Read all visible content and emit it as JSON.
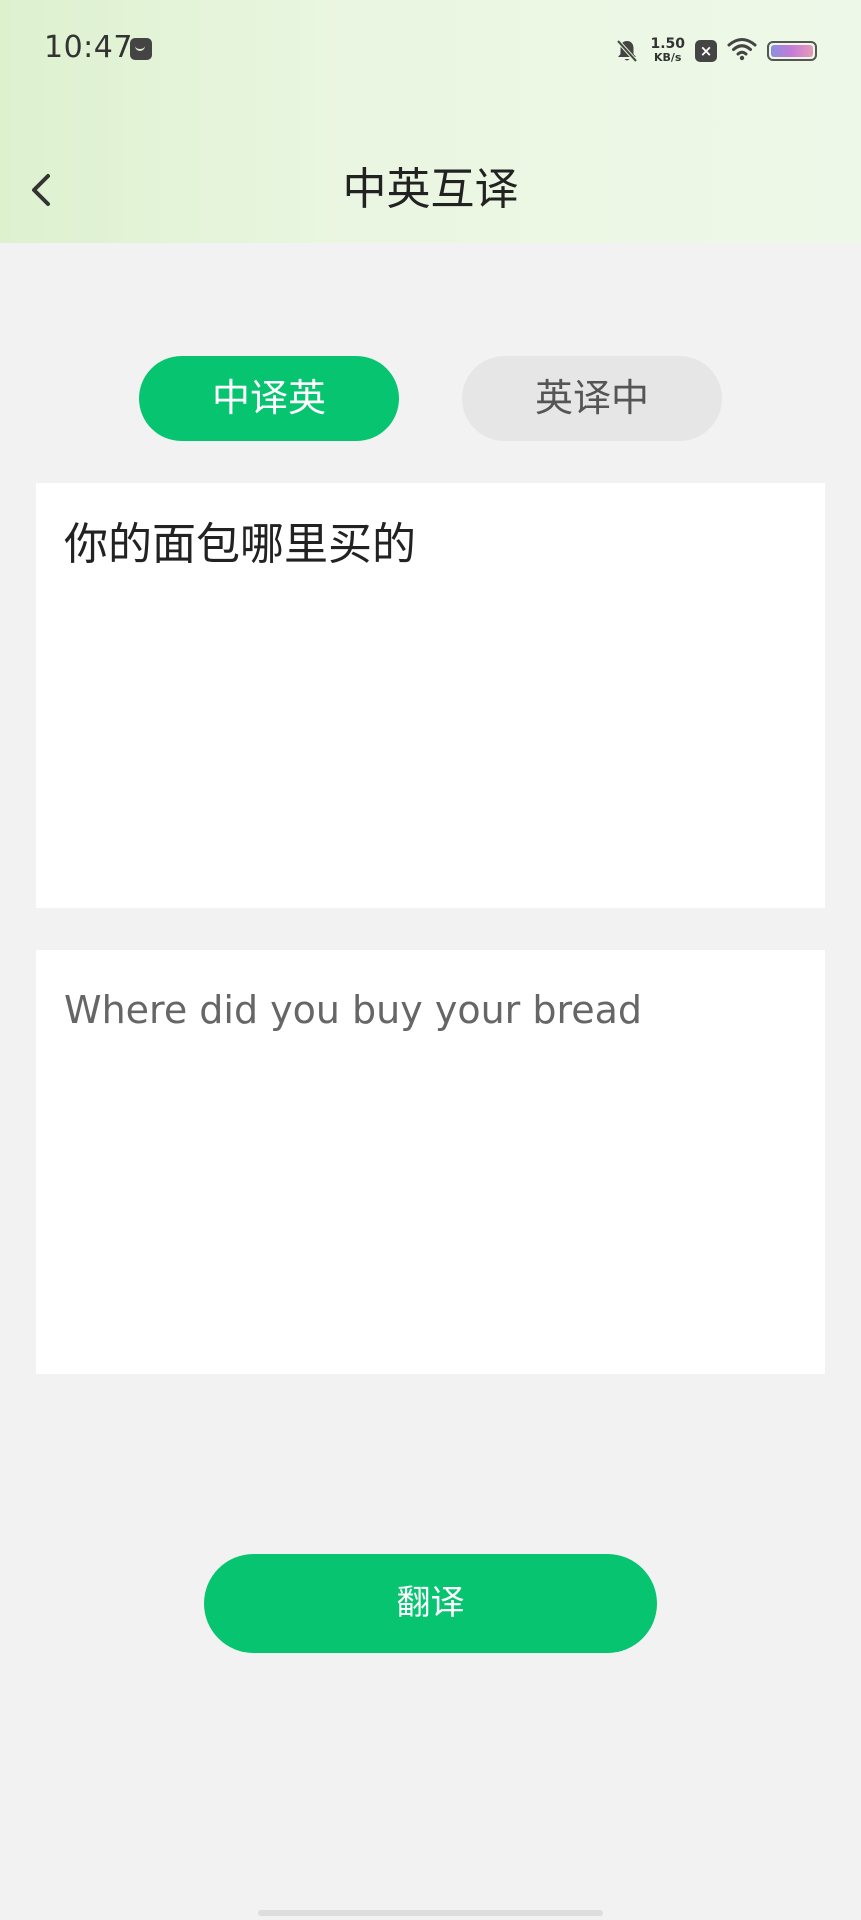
{
  "status_bar": {
    "time": "10:47",
    "net_speed_value": "1.50",
    "net_speed_unit": "KB/s"
  },
  "header": {
    "title": "中英互译"
  },
  "mode_tabs": [
    {
      "label": "中译英",
      "active": true
    },
    {
      "label": "英译中",
      "active": false
    }
  ],
  "source": {
    "text": "你的面包哪里买的"
  },
  "result": {
    "text": "Where did you buy your bread"
  },
  "translate_button": {
    "label": "翻译"
  },
  "colors": {
    "accent": "#06c46f",
    "header_gradient_start": "#ddf1cf",
    "header_gradient_end": "#eef8e8",
    "background": "#f2f2f2"
  },
  "icons": {
    "back": "chevron-left-icon",
    "mute": "bell-off-icon",
    "wifi": "wifi-icon",
    "battery": "battery-icon"
  }
}
